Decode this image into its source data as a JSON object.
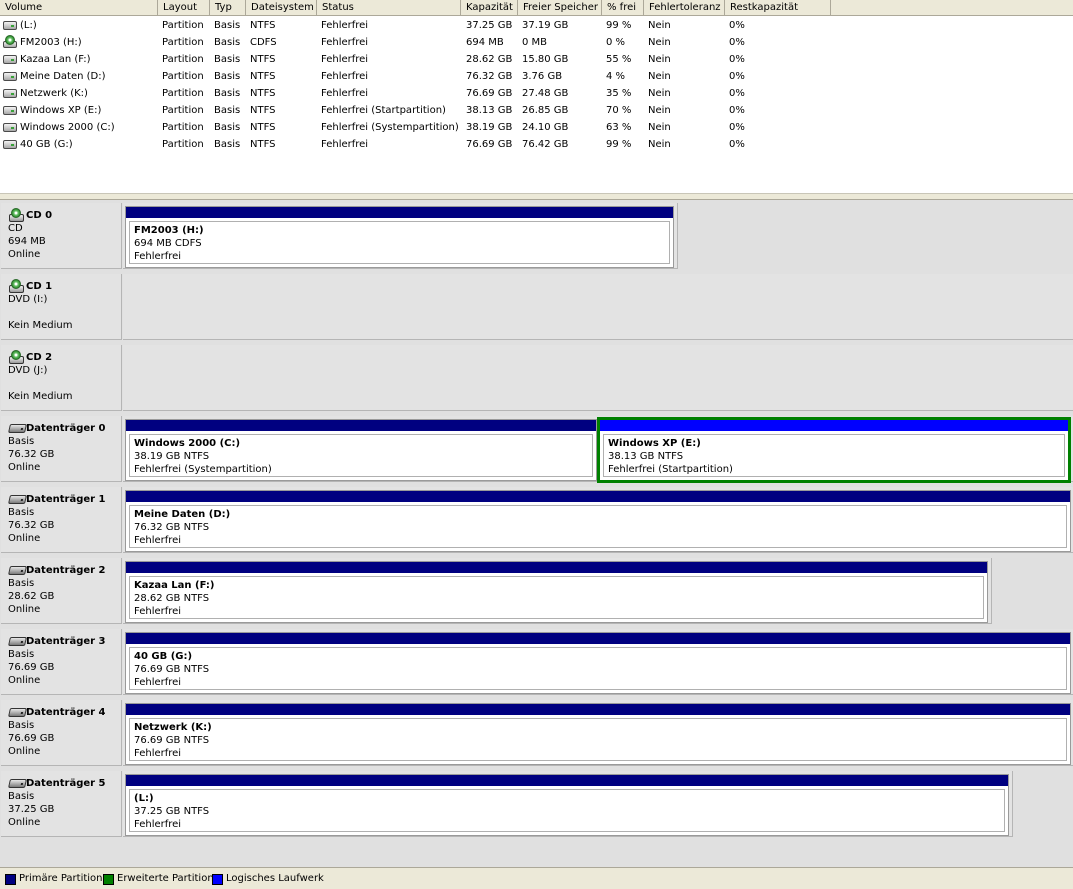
{
  "columns": [
    "Volume",
    "Layout",
    "Typ",
    "Dateisystem",
    "Status",
    "Kapazität",
    "Freier Speicher",
    "% frei",
    "Fehlertoleranz",
    "Restkapazität"
  ],
  "volumes": [
    {
      "icon": "drive-icon",
      "volume": "(L:)",
      "layout": "Partition",
      "typ": "Basis",
      "fs": "NTFS",
      "status": "Fehlerfrei",
      "capacity": "37.25 GB",
      "free": "37.19 GB",
      "pct": "99 %",
      "fault": "Nein",
      "rest": "0%"
    },
    {
      "icon": "cd-drive-icon",
      "volume": "FM2003 (H:)",
      "layout": "Partition",
      "typ": "Basis",
      "fs": "CDFS",
      "status": "Fehlerfrei",
      "capacity": "694 MB",
      "free": "0 MB",
      "pct": "0 %",
      "fault": "Nein",
      "rest": "0%"
    },
    {
      "icon": "drive-icon",
      "volume": "Kazaa Lan (F:)",
      "layout": "Partition",
      "typ": "Basis",
      "fs": "NTFS",
      "status": "Fehlerfrei",
      "capacity": "28.62 GB",
      "free": "15.80 GB",
      "pct": "55 %",
      "fault": "Nein",
      "rest": "0%"
    },
    {
      "icon": "drive-icon",
      "volume": "Meine Daten (D:)",
      "layout": "Partition",
      "typ": "Basis",
      "fs": "NTFS",
      "status": "Fehlerfrei",
      "capacity": "76.32 GB",
      "free": "3.76 GB",
      "pct": "4 %",
      "fault": "Nein",
      "rest": "0%"
    },
    {
      "icon": "drive-icon",
      "volume": "Netzwerk (K:)",
      "layout": "Partition",
      "typ": "Basis",
      "fs": "NTFS",
      "status": "Fehlerfrei",
      "capacity": "76.69 GB",
      "free": "27.48 GB",
      "pct": "35 %",
      "fault": "Nein",
      "rest": "0%"
    },
    {
      "icon": "drive-icon",
      "volume": "Windows XP (E:)",
      "layout": "Partition",
      "typ": "Basis",
      "fs": "NTFS",
      "status": "Fehlerfrei (Startpartition)",
      "capacity": "38.13 GB",
      "free": "26.85 GB",
      "pct": "70 %",
      "fault": "Nein",
      "rest": "0%"
    },
    {
      "icon": "drive-icon",
      "volume": "Windows 2000 (C:)",
      "layout": "Partition",
      "typ": "Basis",
      "fs": "NTFS",
      "status": "Fehlerfrei (Systempartition)",
      "capacity": "38.19 GB",
      "free": "24.10 GB",
      "pct": "63 %",
      "fault": "Nein",
      "rest": "0%"
    },
    {
      "icon": "drive-icon",
      "volume": "40 GB (G:)",
      "layout": "Partition",
      "typ": "Basis",
      "fs": "NTFS",
      "status": "Fehlerfrei",
      "capacity": "76.69 GB",
      "free": "76.42 GB",
      "pct": "99 %",
      "fault": "Nein",
      "rest": "0%"
    }
  ],
  "disks": [
    {
      "icon": "cd-rom-icon",
      "name": "CD 0",
      "line1": "CD",
      "line2": "694 MB",
      "line3": "Online",
      "partitions": [
        {
          "label": "FM2003  (H:)",
          "size": "694 MB CDFS",
          "status": "Fehlerfrei"
        }
      ]
    },
    {
      "icon": "cd-rom-icon",
      "name": "CD 1",
      "line1": "DVD (I:)",
      "line2": "",
      "line3": "Kein Medium",
      "partitions": []
    },
    {
      "icon": "cd-rom-icon",
      "name": "CD 2",
      "line1": "DVD (J:)",
      "line2": "",
      "line3": "Kein Medium",
      "partitions": []
    },
    {
      "icon": "hard-disk-icon",
      "name": "Datenträger 0",
      "line1": "Basis",
      "line2": "76.32 GB",
      "line3": "Online",
      "partitions": [
        {
          "label": "Windows 2000  (C:)",
          "size": "38.19 GB NTFS",
          "status": "Fehlerfrei (Systempartition)"
        },
        {
          "label": "Windows XP  (E:)",
          "size": "38.13 GB NTFS",
          "status": "Fehlerfrei (Startpartition)"
        }
      ]
    },
    {
      "icon": "hard-disk-icon",
      "name": "Datenträger 1",
      "line1": "Basis",
      "line2": "76.32 GB",
      "line3": "Online",
      "partitions": [
        {
          "label": "Meine Daten  (D:)",
          "size": "76.32 GB NTFS",
          "status": "Fehlerfrei"
        }
      ]
    },
    {
      "icon": "hard-disk-icon",
      "name": "Datenträger 2",
      "line1": "Basis",
      "line2": "28.62 GB",
      "line3": "Online",
      "partitions": [
        {
          "label": "Kazaa Lan  (F:)",
          "size": "28.62 GB NTFS",
          "status": "Fehlerfrei"
        }
      ]
    },
    {
      "icon": "hard-disk-icon",
      "name": "Datenträger 3",
      "line1": "Basis",
      "line2": "76.69 GB",
      "line3": "Online",
      "partitions": [
        {
          "label": "40 GB  (G:)",
          "size": "76.69 GB NTFS",
          "status": "Fehlerfrei"
        }
      ]
    },
    {
      "icon": "hard-disk-icon",
      "name": "Datenträger 4",
      "line1": "Basis",
      "line2": "76.69 GB",
      "line3": "Online",
      "partitions": [
        {
          "label": "Netzwerk  (K:)",
          "size": "76.69 GB NTFS",
          "status": "Fehlerfrei"
        }
      ]
    },
    {
      "icon": "hard-disk-icon",
      "name": "Datenträger 5",
      "line1": "Basis",
      "line2": "37.25 GB",
      "line3": "Online",
      "partitions": [
        {
          "label": "(L:)",
          "size": "37.25 GB NTFS",
          "status": "Fehlerfrei"
        }
      ]
    }
  ],
  "legend": [
    {
      "label": "Primäre Partition",
      "color": "#000080"
    },
    {
      "label": "Erweiterte Partition",
      "color": "#008000"
    },
    {
      "label": "Logisches Laufwerk",
      "color": "#0000ff"
    }
  ],
  "colors": {
    "primary_bar": "#000080",
    "selected_border": "#008000",
    "selected_bar": "#0000ff"
  }
}
